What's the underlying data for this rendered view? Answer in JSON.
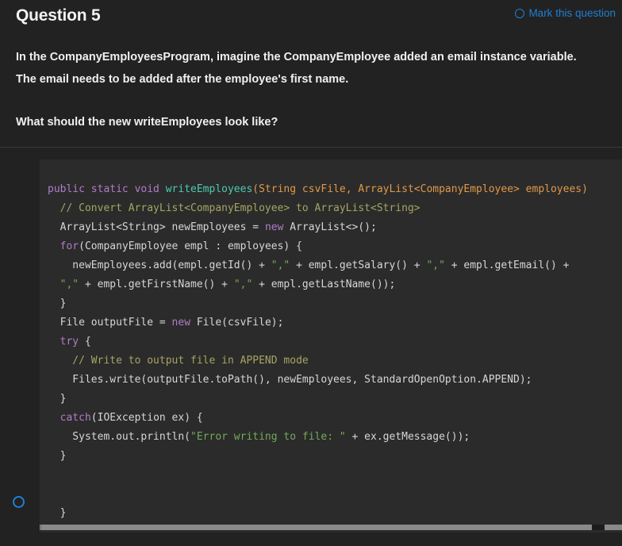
{
  "header": {
    "title": "Question 5",
    "mark_label": "Mark this question",
    "mark_icon": "circle-outline-icon",
    "mark_color": "#1f7fd4"
  },
  "question": {
    "paragraphs": [
      "In the CompanyEmployeesProgram, imagine the CompanyEmployee added an email instance variable. The email needs to be added after the employee's first name.",
      "What should the new writeEmployees look like?"
    ]
  },
  "answer": {
    "radio_icon": "radio-unselected-icon",
    "radio_color": "#1f7fd4",
    "selected": false
  },
  "code": {
    "language": "java",
    "theme_background": "#2b2b2b",
    "colors": {
      "keyword": "#b07cc6",
      "method": "#4ec9b0",
      "parameter": "#e0984a",
      "comment": "#a5a563",
      "string": "#73a95a",
      "plain": "#d6d6d6"
    },
    "lines": [
      [
        {
          "t": "public static void ",
          "c": "kw"
        },
        {
          "t": "writeEmployees",
          "c": "mth"
        },
        {
          "t": "(",
          "c": "par"
        },
        {
          "t": "String csvFile, ArrayList<CompanyEmployee> employees)",
          "c": "par"
        }
      ],
      [
        {
          "t": "  // Convert ArrayList<CompanyEmployee> to ArrayList<String>",
          "c": "cmt"
        }
      ],
      [
        {
          "t": "  ArrayList<String> newEmployees = ",
          "c": "pl"
        },
        {
          "t": "new",
          "c": "kw"
        },
        {
          "t": " ArrayList<>();",
          "c": "pl"
        }
      ],
      [
        {
          "t": "  ",
          "c": "pl"
        },
        {
          "t": "for",
          "c": "kw"
        },
        {
          "t": "(CompanyEmployee empl : employees) {",
          "c": "pl"
        }
      ],
      [
        {
          "t": "    newEmployees.add(empl.getId() + ",
          "c": "pl"
        },
        {
          "t": "\",\"",
          "c": "str"
        },
        {
          "t": " + empl.getSalary() + ",
          "c": "pl"
        },
        {
          "t": "\",\"",
          "c": "str"
        },
        {
          "t": " + empl.getEmail() +",
          "c": "pl"
        }
      ],
      [
        {
          "t": "  ",
          "c": "pl"
        },
        {
          "t": "\",\"",
          "c": "str"
        },
        {
          "t": " + empl.getFirstName() + ",
          "c": "pl"
        },
        {
          "t": "\",\"",
          "c": "str"
        },
        {
          "t": " + empl.getLastName());",
          "c": "pl"
        }
      ],
      [
        {
          "t": "  }",
          "c": "pl"
        }
      ],
      [
        {
          "t": "  File outputFile = ",
          "c": "pl"
        },
        {
          "t": "new",
          "c": "kw"
        },
        {
          "t": " File(csvFile);",
          "c": "pl"
        }
      ],
      [
        {
          "t": "  ",
          "c": "pl"
        },
        {
          "t": "try",
          "c": "kw"
        },
        {
          "t": " {",
          "c": "pl"
        }
      ],
      [
        {
          "t": "    // Write to output file in APPEND mode",
          "c": "cmt"
        }
      ],
      [
        {
          "t": "    Files.write(outputFile.toPath(), newEmployees, StandardOpenOption.APPEND);",
          "c": "pl"
        }
      ],
      [
        {
          "t": "  }",
          "c": "pl"
        }
      ],
      [
        {
          "t": "  ",
          "c": "pl"
        },
        {
          "t": "catch",
          "c": "kw"
        },
        {
          "t": "(IOException ex) {",
          "c": "pl"
        }
      ],
      [
        {
          "t": "    System.out.println(",
          "c": "pl"
        },
        {
          "t": "\"Error writing to file: \"",
          "c": "str"
        },
        {
          "t": " + ex.getMessage());",
          "c": "pl"
        }
      ],
      [
        {
          "t": "  }",
          "c": "pl"
        }
      ],
      [
        {
          "t": "",
          "c": "pl"
        }
      ],
      [
        {
          "t": "",
          "c": "pl"
        }
      ],
      [
        {
          "t": "  }",
          "c": "pl"
        }
      ]
    ]
  },
  "scrollbar": {
    "orientation": "horizontal",
    "thumb_color": "#8a8a8a",
    "track_color": "#1c1c1c"
  }
}
